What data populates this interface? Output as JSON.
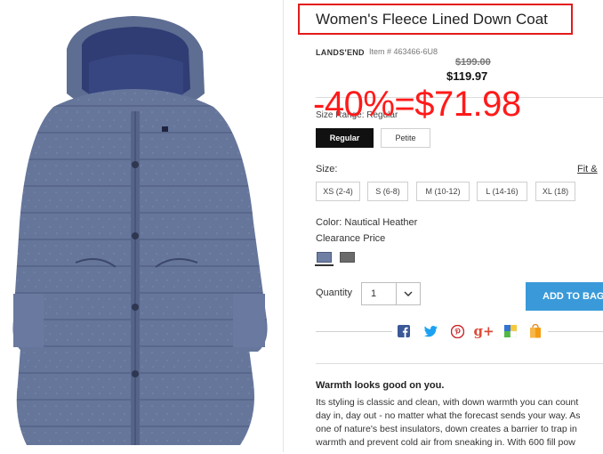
{
  "product": {
    "title": "Women's Fleece Lined Down Coat",
    "brand": "LANDS'END",
    "item_number": "Item # 463466-6U8",
    "old_price": "$199.00",
    "price": "$119.97"
  },
  "overlay": {
    "discount_text": "-40%=$71.98"
  },
  "size_range": {
    "label": "Size Range: Regular",
    "options": [
      "Regular",
      "Petite"
    ],
    "selected": "Regular"
  },
  "size": {
    "label": "Size:",
    "fit_link": "Fit &",
    "options": [
      "XS (2-4)",
      "S (6-8)",
      "M (10-12)",
      "L (14-16)",
      "XL (18)"
    ]
  },
  "color": {
    "label": "Color: Nautical Heather",
    "clearance": "Clearance Price",
    "swatches": [
      {
        "name": "Nautical Heather",
        "hex": "#6f7fa3"
      },
      {
        "name": "Grey",
        "hex": "#6a6a6a"
      }
    ]
  },
  "quantity": {
    "label": "Quantity",
    "value": "1"
  },
  "add_to_bag": "ADD TO BAG",
  "share_icons": [
    "facebook-icon",
    "twitter-icon",
    "pinterest-icon",
    "google-plus-icon",
    "delicious-icon",
    "shopping-bag-icon"
  ],
  "description": {
    "heading": "Warmth looks good on you.",
    "lines": [
      "Its styling is classic and clean, with down warmth you can count",
      "day in, day out - no matter what the forecast sends your way. As",
      "one of nature's best insulators, down creates a barrier to trap in",
      "warmth and prevent cold air from sneaking in. With 600 fill pow"
    ]
  },
  "colors": {
    "title_border": "#e21b1b",
    "overlay": "#ff1a1a",
    "cta": "#3a9ad9",
    "coat": "#5f6e93"
  }
}
